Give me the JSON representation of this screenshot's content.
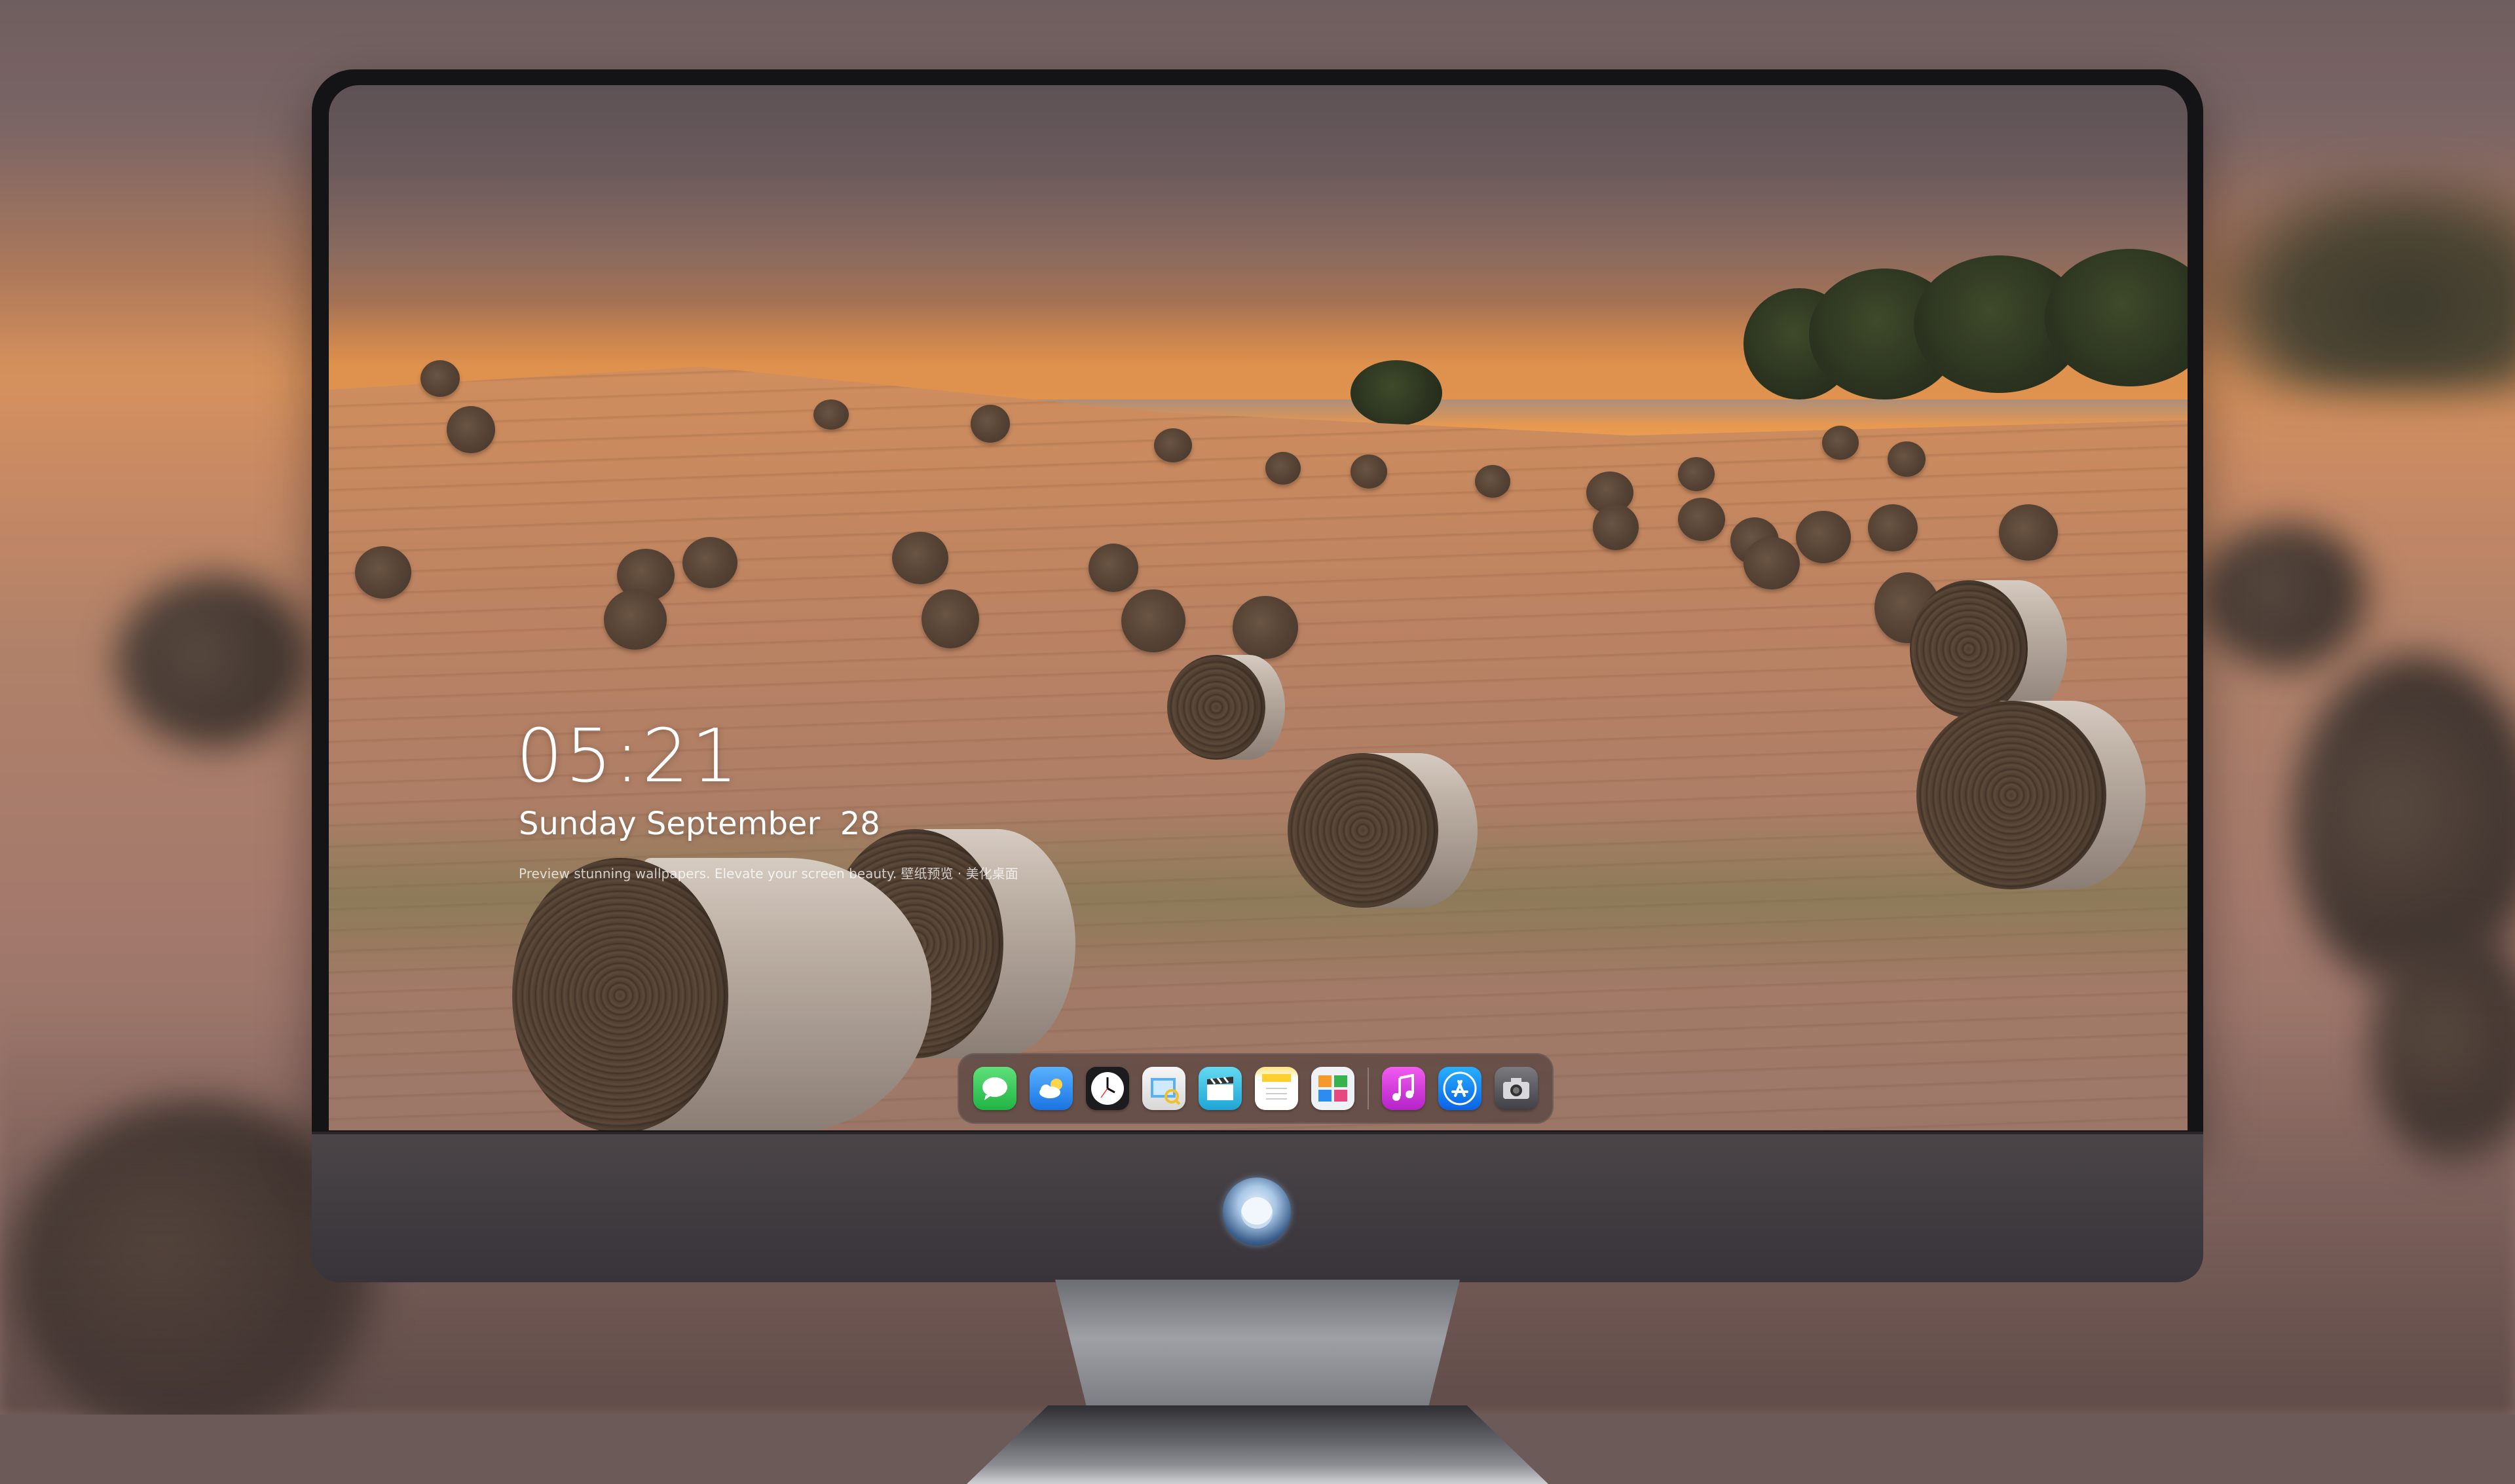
{
  "lock_screen": {
    "time": "05:21",
    "date": "Sunday September  28",
    "tagline": "Preview stunning wallpapers. Elevate your screen beauty. 壁纸预览 · 美化桌面"
  },
  "dock": {
    "items": [
      {
        "name": "messages",
        "icon": "message-bubble-icon",
        "color": "#2fc94a"
      },
      {
        "name": "weather",
        "icon": "cloud-sun-icon",
        "color": "#2e8ff0"
      },
      {
        "name": "clock",
        "icon": "clock-icon",
        "color": "#1c1c1e"
      },
      {
        "name": "preview",
        "icon": "photo-preview-icon",
        "color": "#f0d060"
      },
      {
        "name": "video",
        "icon": "clapperboard-icon",
        "color": "#41c7e8"
      },
      {
        "name": "notes",
        "icon": "notes-icon",
        "color": "#ffd84a"
      },
      {
        "name": "photos-board",
        "icon": "photo-grid-icon",
        "color": "#e9eef3"
      },
      {
        "name": "music",
        "icon": "music-note-icon",
        "color": "#d13ad8"
      },
      {
        "name": "app-store",
        "icon": "app-store-icon",
        "color": "#1a7ef5"
      },
      {
        "name": "camera",
        "icon": "camera-icon",
        "color": "#4a4a4e"
      }
    ]
  },
  "monitor": {
    "brand_logo": "cat-mascot-logo"
  }
}
